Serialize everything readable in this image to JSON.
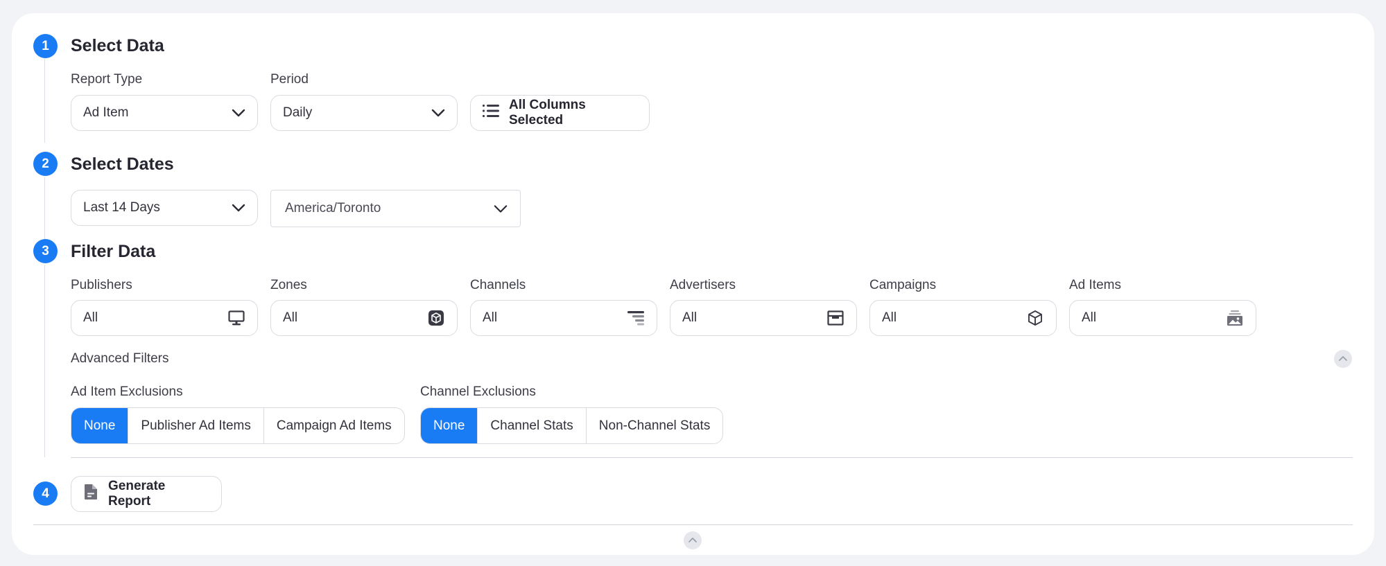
{
  "select_data": {
    "step": "1",
    "title": "Select Data",
    "report_type": {
      "label": "Report Type",
      "value": "Ad Item"
    },
    "period": {
      "label": "Period",
      "value": "Daily"
    },
    "columns_button": "All Columns Selected"
  },
  "select_dates": {
    "step": "2",
    "title": "Select Dates",
    "range": "Last 14 Days",
    "timezone": "America/Toronto"
  },
  "filter_data": {
    "step": "3",
    "title": "Filter Data",
    "filters": [
      {
        "label": "Publishers",
        "value": "All",
        "icon": "monitor-icon"
      },
      {
        "label": "Zones",
        "value": "All",
        "icon": "zone-cube-icon"
      },
      {
        "label": "Channels",
        "value": "All",
        "icon": "channels-icon"
      },
      {
        "label": "Advertisers",
        "value": "All",
        "icon": "advertiser-icon"
      },
      {
        "label": "Campaigns",
        "value": "All",
        "icon": "campaign-box-icon"
      },
      {
        "label": "Ad Items",
        "value": "All",
        "icon": "ad-image-icon"
      }
    ],
    "advanced_filters": "Advanced Filters",
    "ad_item_exclusions": {
      "label": "Ad Item Exclusions",
      "options": [
        "None",
        "Publisher Ad Items",
        "Campaign Ad Items"
      ],
      "selected": "None"
    },
    "channel_exclusions": {
      "label": "Channel Exclusions",
      "options": [
        "None",
        "Channel Stats",
        "Non-Channel Stats"
      ],
      "selected": "None"
    }
  },
  "generate": {
    "step": "4",
    "button": "Generate Report"
  },
  "colors": {
    "accent": "#1a7cf5",
    "background": "#f2f3f6",
    "card": "#ffffff"
  }
}
